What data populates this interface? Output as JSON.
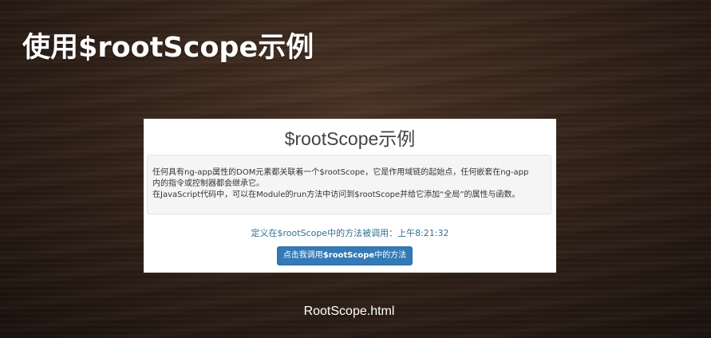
{
  "slide": {
    "title": "使用$rootScope示例",
    "caption": "RootScope.html"
  },
  "demo": {
    "heading": "$rootScope示例",
    "description_lines": [
      "任何具有ng-app属性的DOM元素都关联着一个$rootScope，它是作用域链的起始点，任何嵌套在ng-app",
      "内的指令或控制器都会继承它。",
      "在JavaScript代码中，可以在Module的run方法中访问到$rootScope并给它添加“全局”的属性与函数。"
    ],
    "status_text": "定义在$rootScope中的方法被调用：上午8:21:32",
    "button": {
      "prefix": "点击我调用",
      "bold": "$rootScope",
      "suffix": "中的方法"
    }
  },
  "colors": {
    "button": "#337ab7",
    "status_text": "#31708f",
    "panel_bg": "#ffffff",
    "well_bg": "#f5f5f5"
  }
}
